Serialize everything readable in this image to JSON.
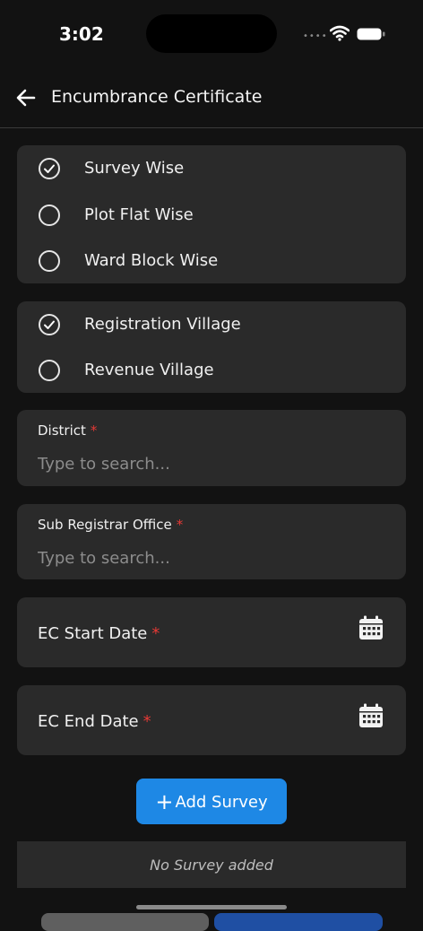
{
  "status_bar": {
    "time": "3:02",
    "signal_dots": "••••"
  },
  "header": {
    "title": "Encumbrance Certificate",
    "back_icon": "arrow-left-icon"
  },
  "search_type": {
    "options": [
      {
        "label": "Survey Wise",
        "selected": true
      },
      {
        "label": "Plot Flat Wise",
        "selected": false
      },
      {
        "label": "Ward Block Wise",
        "selected": false
      }
    ]
  },
  "village_type": {
    "options": [
      {
        "label": "Registration Village",
        "selected": true
      },
      {
        "label": "Revenue Village",
        "selected": false
      }
    ]
  },
  "district": {
    "label": "District",
    "required_mark": "*",
    "placeholder": "Type to search...",
    "value": ""
  },
  "sub_registrar_office": {
    "label": "Sub Registrar Office",
    "required_mark": "*",
    "placeholder": "Type to search...",
    "value": ""
  },
  "ec_start_date": {
    "label": "EC Start Date",
    "required_mark": "*",
    "icon": "calendar-icon"
  },
  "ec_end_date": {
    "label": "EC End Date",
    "required_mark": "*",
    "icon": "calendar-icon"
  },
  "add_survey": {
    "label": "Add Survey",
    "icon": "plus-icon"
  },
  "survey_list": {
    "empty_text": "No Survey added"
  },
  "colors": {
    "background": "#121212",
    "card": "#2a2a2a",
    "accent": "#1e88e5",
    "required": "#e53935"
  }
}
